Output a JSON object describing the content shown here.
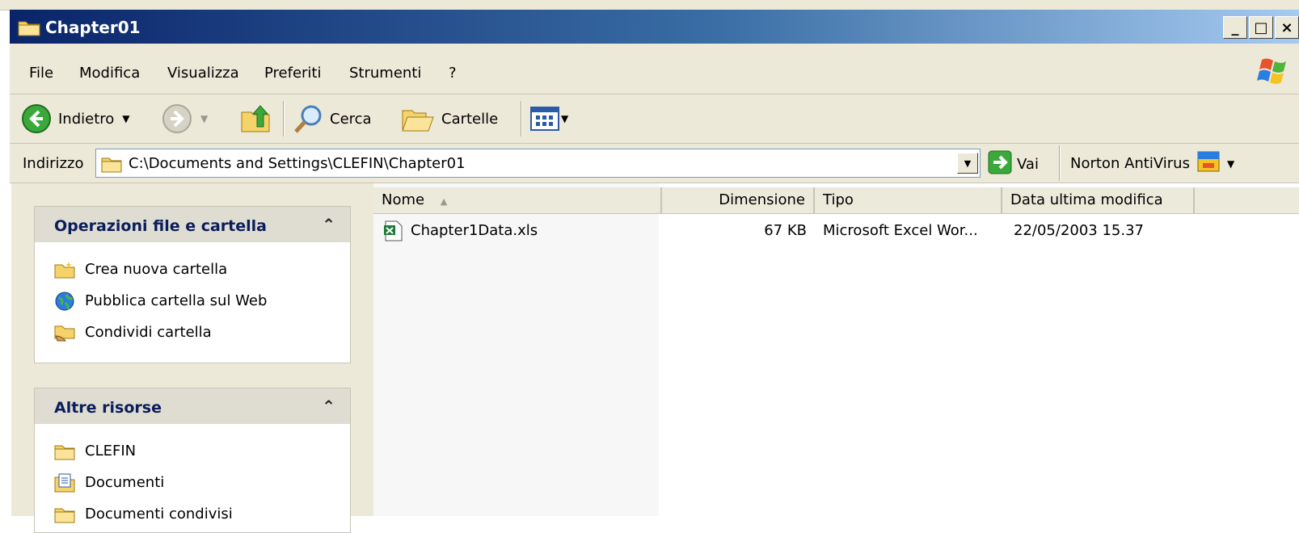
{
  "window": {
    "title": "Chapter01",
    "controls": [
      "_",
      "□",
      "×"
    ]
  },
  "menu": {
    "items": [
      "File",
      "Modifica",
      "Visualizza",
      "Preferiti",
      "Strumenti",
      "?"
    ]
  },
  "toolbar": {
    "back_label": "Indietro",
    "search_label": "Cerca",
    "folders_label": "Cartelle"
  },
  "address": {
    "label": "Indirizzo",
    "path": "C:\\Documents and Settings\\CLEFIN\\Chapter01",
    "go_label": "Vai",
    "norton_label": "Norton AntiVirus"
  },
  "taskpane": {
    "file_ops": {
      "title": "Operazioni file e cartella",
      "items": [
        "Crea nuova cartella",
        "Pubblica cartella sul Web",
        "Condividi cartella"
      ]
    },
    "other_places": {
      "title": "Altre risorse",
      "items": [
        "CLEFIN",
        "Documenti",
        "Documenti condivisi"
      ]
    }
  },
  "list": {
    "columns": [
      "Nome",
      "Dimensione",
      "Tipo",
      "Data ultima modifica"
    ],
    "rows": [
      {
        "name": "Chapter1Data.xls",
        "size": "67 KB",
        "type": "Microsoft Excel Wor...",
        "modified": "22/05/2003 15.37"
      }
    ]
  },
  "colors": {
    "titlebar_start": "#0a246a",
    "titlebar_end": "#a6caf0",
    "chrome": "#ece9d8",
    "panel_title": "#0a1d5c"
  }
}
